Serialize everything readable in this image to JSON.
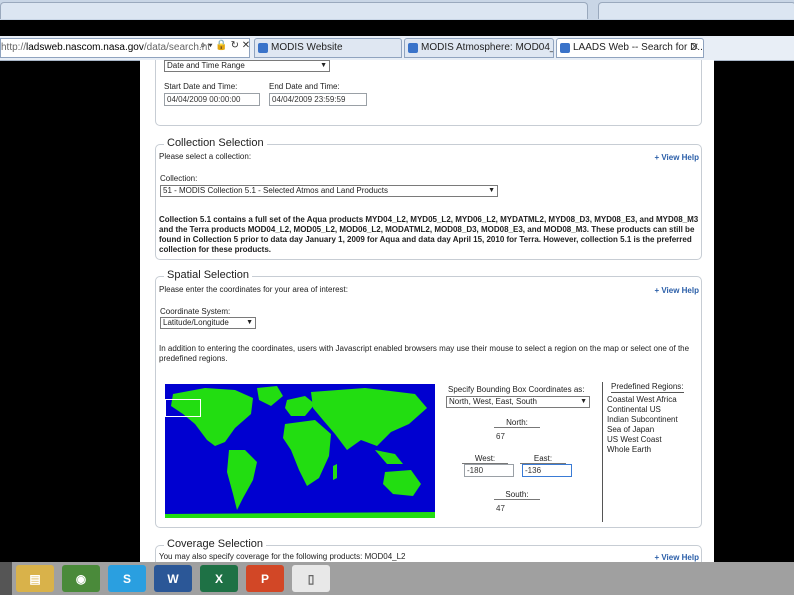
{
  "browser": {
    "address": {
      "prefix": "http://",
      "host": "ladsweb.nascom.nasa.gov",
      "path": "/data/search.ht"
    },
    "tabs": [
      {
        "label": "MODIS Website"
      },
      {
        "label": "MODIS Atmosphere: MOD04_L..."
      },
      {
        "label": "LAADS Web -- Search for D..."
      }
    ],
    "close_glyph": "✕"
  },
  "time_section": {
    "range_select": "Date and Time Range",
    "start_label": "Start Date and Time:",
    "start_value": "04/04/2009 00:00:00",
    "end_label": "End Date and Time:",
    "end_value": "04/04/2009 23:59:59"
  },
  "collection": {
    "legend": "Collection Selection",
    "prompt": "Please select a collection:",
    "help": "+ View Help",
    "field_label": "Collection:",
    "selected": "51 - MODIS Collection 5.1 - Selected Atmos and Land Products",
    "note": "Collection 5.1 contains a full set of the Aqua products MYD04_L2, MYD05_L2, MYD06_L2, MYDATML2, MYD08_D3, MYD08_E3, and MYD08_M3 and the Terra products MOD04_L2, MOD05_L2, MOD06_L2, MODATML2, MOD08_D3, MOD08_E3, and MOD08_M3. These products can still be found in Collection 5 prior to data day January 1, 2009 for Aqua and data day April 15, 2010 for Terra. However, collection 5.1 is the preferred collection for these products."
  },
  "spatial": {
    "legend": "Spatial Selection",
    "prompt": "Please enter the coordinates for your area of interest:",
    "help": "+ View Help",
    "coord_label": "Coordinate System:",
    "coord_selected": "Latitude/Longitude",
    "info": "In addition to entering the coordinates, users with Javascript enabled browsers may use their mouse to select a region on the map or select one of the predefined regions.",
    "bbox_label": "Specify Bounding Box Coordinates as:",
    "bbox_order": "North, West, East, South",
    "north_label": "North:",
    "north_value": "67",
    "west_label": "West:",
    "west_value": "-180",
    "east_label": "East:",
    "east_value": "-136",
    "south_label": "South:",
    "south_value": "47",
    "regions_title": "Predefined Regions:",
    "regions": [
      "Coastal West Africa",
      "Continental US",
      "Indian Subcontinent",
      "Sea of Japan",
      "US West Coast",
      "Whole Earth"
    ]
  },
  "coverage": {
    "legend": "Coverage Selection",
    "prompt": "You may also specify coverage for the following products: MOD04_L2",
    "help": "+ View Help"
  },
  "colors": {
    "map_ocean": "#0000d0",
    "map_land": "#22dd11",
    "link": "#2a5ea8"
  },
  "taskbar_icons": [
    "file-explorer-icon",
    "chrome-icon",
    "skype-icon",
    "word-icon",
    "excel-icon",
    "powerpoint-icon",
    "blank-document-icon"
  ]
}
